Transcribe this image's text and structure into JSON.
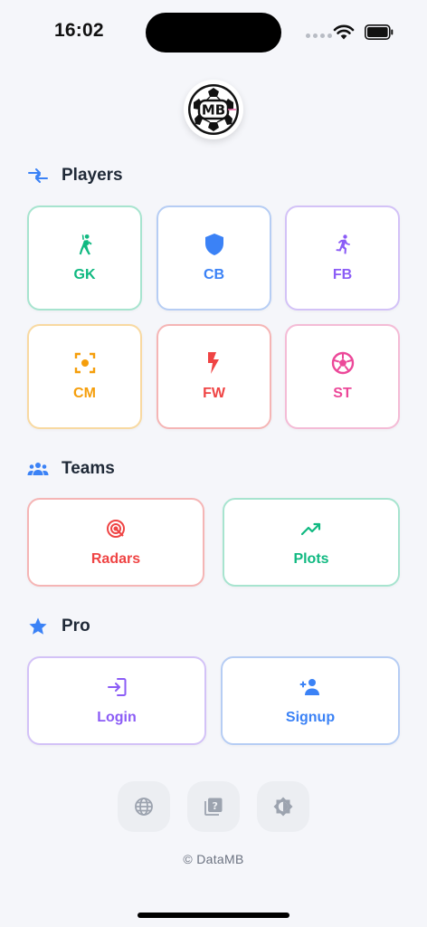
{
  "status_bar": {
    "time": "16:02"
  },
  "sections": {
    "players": {
      "title": "Players",
      "items": [
        {
          "label": "GK",
          "icon": "goalkeeper-icon",
          "color": "#10b981",
          "border": "#a7e4cf"
        },
        {
          "label": "CB",
          "icon": "shield-icon",
          "color": "#3b82f6",
          "border": "#b6cdf4"
        },
        {
          "label": "FB",
          "icon": "running-icon",
          "color": "#8b5cf6",
          "border": "#d3c2f7"
        },
        {
          "label": "CM",
          "icon": "target-center-icon",
          "color": "#f59e0b",
          "border": "#f8d9a1"
        },
        {
          "label": "FW",
          "icon": "lightning-icon",
          "color": "#ef4444",
          "border": "#f5b5b5"
        },
        {
          "label": "ST",
          "icon": "football-icon",
          "color": "#ec4899",
          "border": "#f4bbd6"
        }
      ]
    },
    "teams": {
      "title": "Teams",
      "items": [
        {
          "label": "Radars",
          "icon": "radar-icon",
          "color": "#ef4444",
          "border": "#f5b5b5"
        },
        {
          "label": "Plots",
          "icon": "trending-up-icon",
          "color": "#10b981",
          "border": "#a7e4cf"
        }
      ]
    },
    "pro": {
      "title": "Pro",
      "items": [
        {
          "label": "Login",
          "icon": "login-icon",
          "color": "#8b5cf6",
          "border": "#d3c2f7"
        },
        {
          "label": "Signup",
          "icon": "add-user-icon",
          "color": "#3b82f6",
          "border": "#b6cdf4"
        }
      ]
    }
  },
  "footer": {
    "buttons": [
      "globe-icon",
      "help-book-icon",
      "brightness-icon"
    ],
    "copyright": "© DataMB"
  },
  "logo": {
    "text": "MB"
  },
  "colors": {
    "background": "#f5f6fa",
    "accent": "#3b82f6"
  }
}
